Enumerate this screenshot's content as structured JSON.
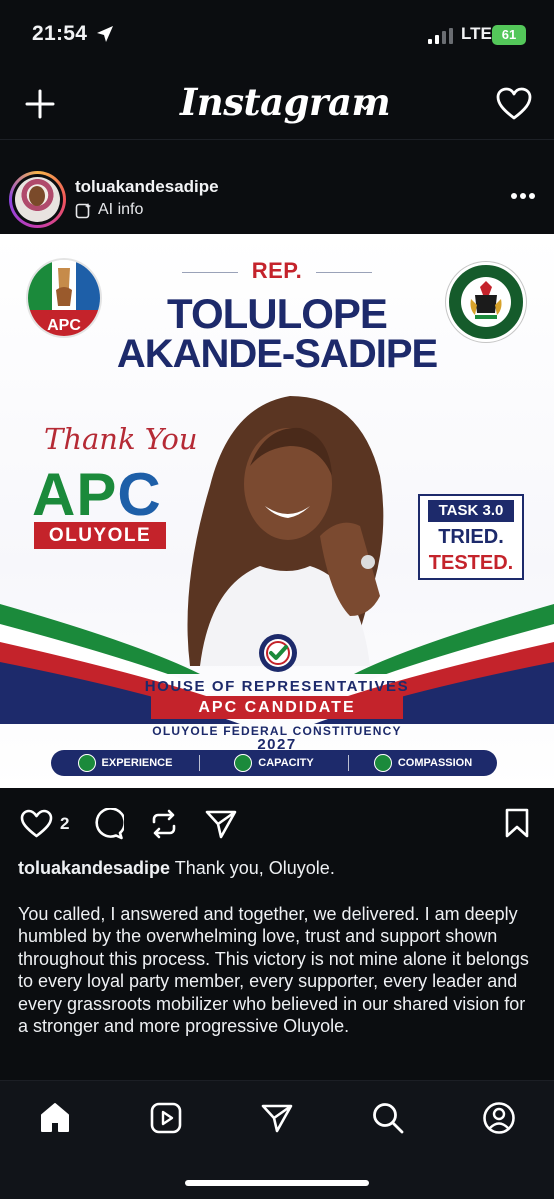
{
  "status_bar": {
    "time": "21:54",
    "network": "LTE",
    "battery": "61",
    "battery_color": "#54c75a"
  },
  "header": {
    "brand": "Instagram",
    "icons": [
      "plus-icon",
      "chevron-down-icon",
      "heart-icon"
    ]
  },
  "post": {
    "username": "toluakandesadipe",
    "ai_info": "AI info",
    "image": {
      "rep": "REP.",
      "name_line1": "TOLULOPE",
      "name_line2": "AKANDE-SADIPE",
      "thanks": "Thank You",
      "party_letters": [
        "A",
        "P",
        "C"
      ],
      "constituency_short": "OLUYOLE",
      "apc_logo_text": "APC",
      "seal_text": "HOUSE OF REPRESENTATIVES",
      "task_tag": "TASK 3.0",
      "task_line1": "TRIED.",
      "task_line2": "TESTED.",
      "house_label": "HOUSE OF REPRESENTATIVES",
      "candidate_label": "APC CANDIDATE",
      "constituency_full": "OLUYOLE FEDERAL CONSTITUENCY",
      "year": "2027",
      "pills": [
        {
          "label": "EXPERIENCE",
          "icon": "person-icon"
        },
        {
          "label": "CAPACITY",
          "icon": "chart-icon"
        },
        {
          "label": "COMPASSION",
          "icon": "heart-icon"
        }
      ],
      "colors": {
        "navy": "#1d2a6b",
        "red": "#c4232b",
        "green": "#1b8a3b"
      }
    },
    "likes": "2",
    "caption_first": "Thank you, Oluyole.",
    "caption_body": "You called, I answered and together, we delivered. I am deeply humbled by the overwhelming love, trust and support shown throughout this process. This victory is not mine alone it belongs to every loyal party member, every supporter, every leader and every grassroots mobilizer who believed in our shared vision for a stronger and more progressive Oluyole."
  },
  "bottom_nav": [
    "home-icon",
    "reels-icon",
    "send-icon",
    "search-icon",
    "profile-icon"
  ]
}
